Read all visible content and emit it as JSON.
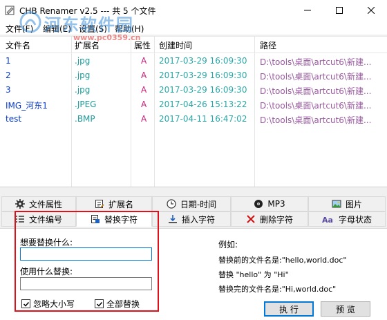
{
  "window": {
    "title": "CHB Renamer v2.5 --- 共 5 个文件",
    "minimize_icon": "minimize-icon",
    "maximize_icon": "maximize-icon",
    "close_icon": "close-icon"
  },
  "menu": {
    "file": "文件(F)",
    "edit": "编辑(E)",
    "settings": "设置(S)",
    "help": "帮助(H)"
  },
  "watermark": {
    "text": "河东软件园",
    "url": "www.pc0359.cn"
  },
  "filelist": {
    "headers": {
      "name": "文件名",
      "ext": "扩展名",
      "attr": "属性",
      "created": "创建时间",
      "path": "路径"
    },
    "rows": [
      {
        "name": "1",
        "ext": ".jpg",
        "attr": "A",
        "created": "2017-03-29 16:09:30",
        "path": "D:\\tools\\桌面\\artcut6\\新建..."
      },
      {
        "name": "2",
        "ext": ".jpg",
        "attr": "A",
        "created": "2017-03-29 16:09:30",
        "path": "D:\\tools\\桌面\\artcut6\\新建..."
      },
      {
        "name": "3",
        "ext": ".jpg",
        "attr": "A",
        "created": "2017-03-29 16:09:30",
        "path": "D:\\tools\\桌面\\artcut6\\新建..."
      },
      {
        "name": "IMG_河东1",
        "ext": ".JPEG",
        "attr": "A",
        "created": "2017-04-26 15:13:22",
        "path": "D:\\tools\\桌面\\artcut6\\新建..."
      },
      {
        "name": "test",
        "ext": ".BMP",
        "attr": "A",
        "created": "2017-04-11 16:47:02",
        "path": "D:\\tools\\桌面\\artcut6\\新建..."
      }
    ]
  },
  "tabs": {
    "row1": {
      "file_attr": "文件属性",
      "ext": "扩展名",
      "datetime": "日期-时间",
      "mp3": "MP3",
      "picture": "图片"
    },
    "row2": {
      "file_number": "文件编号",
      "replace": "替换字符",
      "insert": "插入字符",
      "delete": "删除字符",
      "case": "字母状态"
    },
    "active": "替换字符"
  },
  "replace_panel": {
    "find_label": "想要替换什么:",
    "find_value": "",
    "replace_label": "使用什么替换:",
    "replace_value": "",
    "ignore_case": "忽略大小写",
    "ignore_case_checked": true,
    "replace_all": "全部替换",
    "replace_all_checked": true
  },
  "example": {
    "heading": "例如:",
    "before": "替换前的文件名是:\"hello,world.doc\"",
    "rule": "替换 \"hello\" 为 \"Hi\"",
    "after": "替换完的文件名是:\"Hi,world.doc\""
  },
  "buttons": {
    "execute": "执 行",
    "preview": "预 览"
  },
  "colors": {
    "name": "#0a3cc8",
    "ext": "#1f9a9a",
    "attr": "#c81e78",
    "time": "#2aa8a8",
    "path": "#9a5aa0",
    "highlight": "#e0101a"
  }
}
